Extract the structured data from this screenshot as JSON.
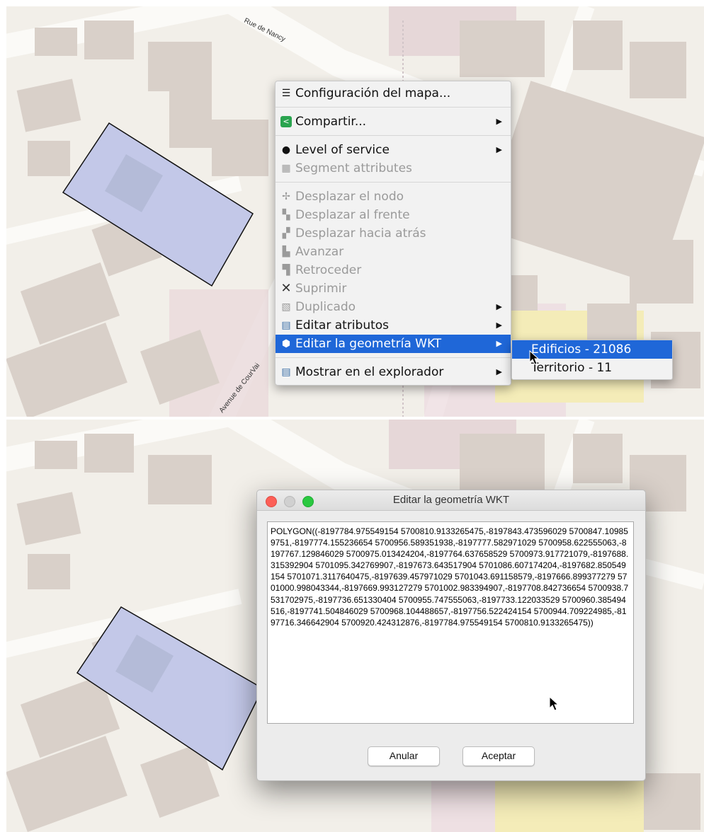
{
  "map": {
    "streets": {
      "rue_nancy": "Rue de Nancy",
      "avenue_courvai": "Avenue de CourVai"
    }
  },
  "colors": {
    "road": "#fbfaf7",
    "land": "#f2efe9",
    "building": "#d9d0c9",
    "selected_polygon": "#c3c8e8",
    "menu_highlight": "#1f67d8"
  },
  "context_menu": {
    "items": [
      {
        "label": "Configuración del mapa...",
        "icon": "map-config-icon",
        "enabled": true
      },
      {
        "label": "Compartir...",
        "icon": "share-icon",
        "enabled": true,
        "submenu": true
      },
      {
        "label": "Level of service",
        "icon": "level-of-service-icon",
        "enabled": true,
        "submenu": true
      },
      {
        "label": "Segment attributes",
        "icon": "segment-attributes-icon",
        "enabled": false
      },
      {
        "label": "Desplazar el nodo",
        "icon": "move-node-icon",
        "enabled": false
      },
      {
        "label": "Desplazar al frente",
        "icon": "bring-to-front-icon",
        "enabled": false
      },
      {
        "label": "Desplazar hacia atrás",
        "icon": "send-to-back-icon",
        "enabled": false
      },
      {
        "label": "Avanzar",
        "icon": "bring-forward-icon",
        "enabled": false
      },
      {
        "label": "Retroceder",
        "icon": "send-backward-icon",
        "enabled": false
      },
      {
        "label": "Suprimir",
        "icon": "delete-icon",
        "enabled": false
      },
      {
        "label": "Duplicado",
        "icon": "duplicate-icon",
        "enabled": false,
        "submenu": true
      },
      {
        "label": "Editar atributos",
        "icon": "table-icon",
        "enabled": true,
        "submenu": true
      },
      {
        "label": "Editar la geometría WKT",
        "icon": "geometry-icon",
        "enabled": true,
        "submenu": true,
        "selected": true
      },
      {
        "label": "Mostrar en el explorador",
        "icon": "table-icon",
        "enabled": true,
        "submenu": true
      }
    ],
    "submenu": [
      {
        "label": "Edificios - 21086",
        "selected": true
      },
      {
        "label": "Territorio - 11",
        "selected": false
      }
    ]
  },
  "dialog": {
    "title": "Editar la geometría WKT",
    "wkt": "POLYGON((-8197784.975549154 5700810.9133265475,-8197843.473596029 5700847.109859751,-8197774.155236654 5700956.589351938,-8197777.582971029 5700958.622555063,-8197767.129846029 5700975.013424204,-8197764.637658529 5700973.917721079,-8197688.315392904 5701095.342769907,-8197673.643517904 5701086.607174204,-8197682.850549154 5701071.3117640475,-8197639.457971029 5701043.691158579,-8197666.899377279 5701000.998043344,-8197669.993127279 5701002.983394907,-8197708.842736654 5700938.7531702975,-8197736.651330404 5700955.747555063,-8197733.122033529 5700960.385494516,-8197741.504846029 5700968.104488657,-8197756.522424154 5700944.709224985,-8197716.346642904 5700920.424312876,-8197784.975549154 5700810.9133265475))",
    "cancel_label": "Anular",
    "accept_label": "Aceptar"
  }
}
